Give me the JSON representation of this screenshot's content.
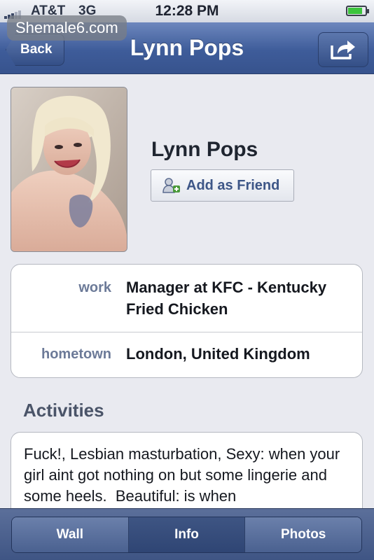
{
  "status_bar": {
    "carrier": "AT&T",
    "network": "3G",
    "time": "12:28 PM"
  },
  "watermark": "Shemale6.com",
  "nav": {
    "back_label": "Back",
    "title": "Lynn Pops",
    "share_icon": "share-icon"
  },
  "profile": {
    "name": "Lynn Pops",
    "add_friend_label": "Add as Friend",
    "add_friend_icon": "add-friend-icon"
  },
  "info": {
    "work_label": "work",
    "work_value": "Manager at KFC - Kentucky Fried Chicken",
    "hometown_label": "hometown",
    "hometown_value": "London, United Kingdom"
  },
  "activities": {
    "header": "Activities",
    "text": "Fuck!, Lesbian masturbation, Sexy: when your girl aint got nothing on but some lingerie and some heels.  Beautiful: is when"
  },
  "tabs": [
    {
      "label": "Wall"
    },
    {
      "label": "Info",
      "active": true
    },
    {
      "label": "Photos"
    }
  ],
  "colors": {
    "nav_blue": "#3e5c9a",
    "background": "#e9eaf0",
    "label_blue": "#6c7a98"
  }
}
